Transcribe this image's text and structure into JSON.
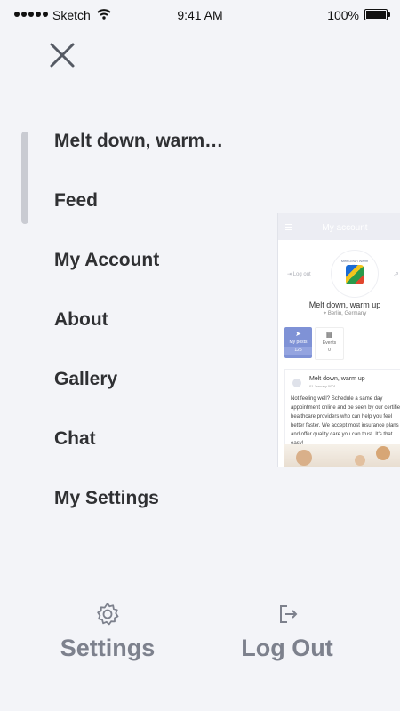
{
  "status_bar": {
    "carrier": "Sketch",
    "time": "9:41 AM",
    "battery": "100%"
  },
  "menu": {
    "items": [
      {
        "label": "Melt down, warm…"
      },
      {
        "label": "Feed"
      },
      {
        "label": "My Account"
      },
      {
        "label": "About"
      },
      {
        "label": "Gallery"
      },
      {
        "label": "Chat"
      },
      {
        "label": "My Settings"
      }
    ]
  },
  "preview": {
    "header_title": "My account",
    "logout_label": "Log out",
    "avatar_text": "Melt Down Warm Up",
    "profile_name": "Melt down, warm up",
    "location": "Berlin, Germany",
    "tabs": [
      {
        "label": "My posts",
        "count": "125"
      },
      {
        "label": "Events",
        "count": "0"
      }
    ],
    "post": {
      "author": "Melt down, warm up",
      "date": "01 January 0001",
      "body": "Not feeling well? Schedule a same day appointment online and be seen by our certified healthcare providers who can help you feel better faster. We accept most insurance plans and offer quality care you can trust. It's that easy!"
    }
  },
  "bottom": {
    "settings_label": "Settings",
    "logout_label": "Log Out"
  },
  "colors": {
    "background": "#f3f4f8",
    "menu_text": "#2f3033",
    "muted": "#7d818d",
    "accent": "#7f92d6"
  }
}
